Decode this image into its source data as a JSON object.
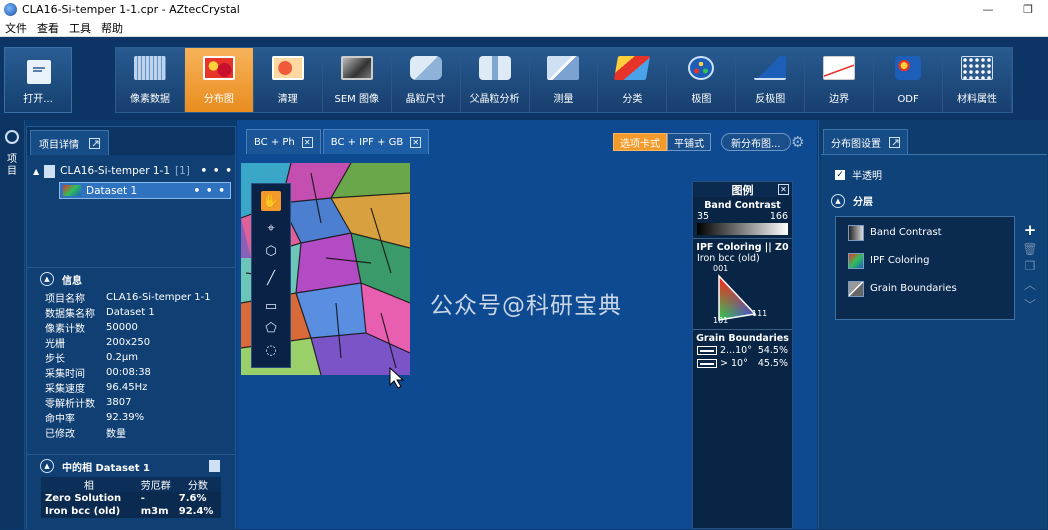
{
  "window": {
    "title": "CLA16-Si-temper 1-1.cpr - AZtecCrystal",
    "min_icon": "—",
    "max_icon": "❐"
  },
  "menu": [
    "文件",
    "查看",
    "工具",
    "帮助"
  ],
  "ribbon": {
    "open_label": "打开...",
    "tools": [
      {
        "label": "像素数据",
        "icon": "pixel-grid-icon",
        "active": false
      },
      {
        "label": "分布图",
        "icon": "map-icon",
        "active": true
      },
      {
        "label": "清理",
        "icon": "cleanup-icon",
        "active": false
      },
      {
        "label": "SEM 图像",
        "icon": "sem-image-icon",
        "active": false
      },
      {
        "label": "晶粒尺寸",
        "icon": "grain-size-icon",
        "active": false
      },
      {
        "label": "父晶粒分析",
        "icon": "parent-grain-icon",
        "active": false
      },
      {
        "label": "测量",
        "icon": "measure-icon",
        "active": false
      },
      {
        "label": "分类",
        "icon": "classify-icon",
        "active": false
      },
      {
        "label": "极图",
        "icon": "pole-figure-icon",
        "active": false
      },
      {
        "label": "反极图",
        "icon": "inverse-pole-figure-icon",
        "active": false
      },
      {
        "label": "边界",
        "icon": "boundary-icon",
        "active": false
      },
      {
        "label": "ODF",
        "icon": "odf-icon",
        "active": false
      },
      {
        "label": "材料属性",
        "icon": "material-props-icon",
        "active": false
      }
    ]
  },
  "left_strip": {
    "label": "项目"
  },
  "project": {
    "tab_label": "项目详情",
    "tree": {
      "project_name": "CLA16-Si-temper 1-1",
      "project_count": "[1]",
      "dataset_name": "Dataset 1",
      "more": "• • •"
    },
    "info": {
      "title": "信息",
      "rows": [
        {
          "k": "项目名称",
          "v": "CLA16-Si-temper 1-1"
        },
        {
          "k": "数据集名称",
          "v": "Dataset 1"
        },
        {
          "k": "像素计数",
          "v": "50000"
        },
        {
          "k": "光栅",
          "v": "200x250"
        },
        {
          "k": "步长",
          "v": "0.2μm"
        },
        {
          "k": "采集时间",
          "v": "00:08:38"
        },
        {
          "k": "采集速度",
          "v": "96.45Hz"
        },
        {
          "k": "零解析计数",
          "v": "3807"
        },
        {
          "k": "命中率",
          "v": "92.39%"
        },
        {
          "k": "已修改",
          "v": "数量"
        }
      ]
    },
    "phases": {
      "title": "中的相 Dataset 1",
      "headers": [
        "相",
        "劳厄群",
        "分数"
      ],
      "rows": [
        [
          "Zero Solution",
          "-",
          "7.6%"
        ],
        [
          "Iron bcc (old)",
          "m3m",
          "92.4%"
        ]
      ]
    }
  },
  "center": {
    "tabs": [
      {
        "label": "BC + Ph"
      },
      {
        "label": "BC + IPF + GB"
      }
    ],
    "view_tabs": "选项卡式",
    "view_tiled": "平铺式",
    "new_map": "新分布图...",
    "watermark": "公众号@科研宝典"
  },
  "legend": {
    "title": "图例",
    "bc": {
      "title": "Band Contrast",
      "min": "35",
      "max": "166"
    },
    "ipf": {
      "title": "IPF Coloring || Z0",
      "phase": "Iron bcc (old)",
      "corners": [
        "001",
        "101",
        "111"
      ]
    },
    "gb": {
      "title": "Grain Boundaries",
      "rows": [
        {
          "label": "2...10°",
          "pct": "54.5%"
        },
        {
          "label": "> 10°",
          "pct": "45.5%"
        }
      ]
    }
  },
  "map_settings": {
    "tab_label": "分布图设置",
    "semi_transparent": "半透明",
    "layers_title": "分层",
    "layers": [
      "Band Contrast",
      "IPF Coloring",
      "Grain Boundaries"
    ]
  },
  "colors": {
    "accent": "#f39a2a",
    "panel": "#0f3f73",
    "workspace": "#0d4a91"
  }
}
